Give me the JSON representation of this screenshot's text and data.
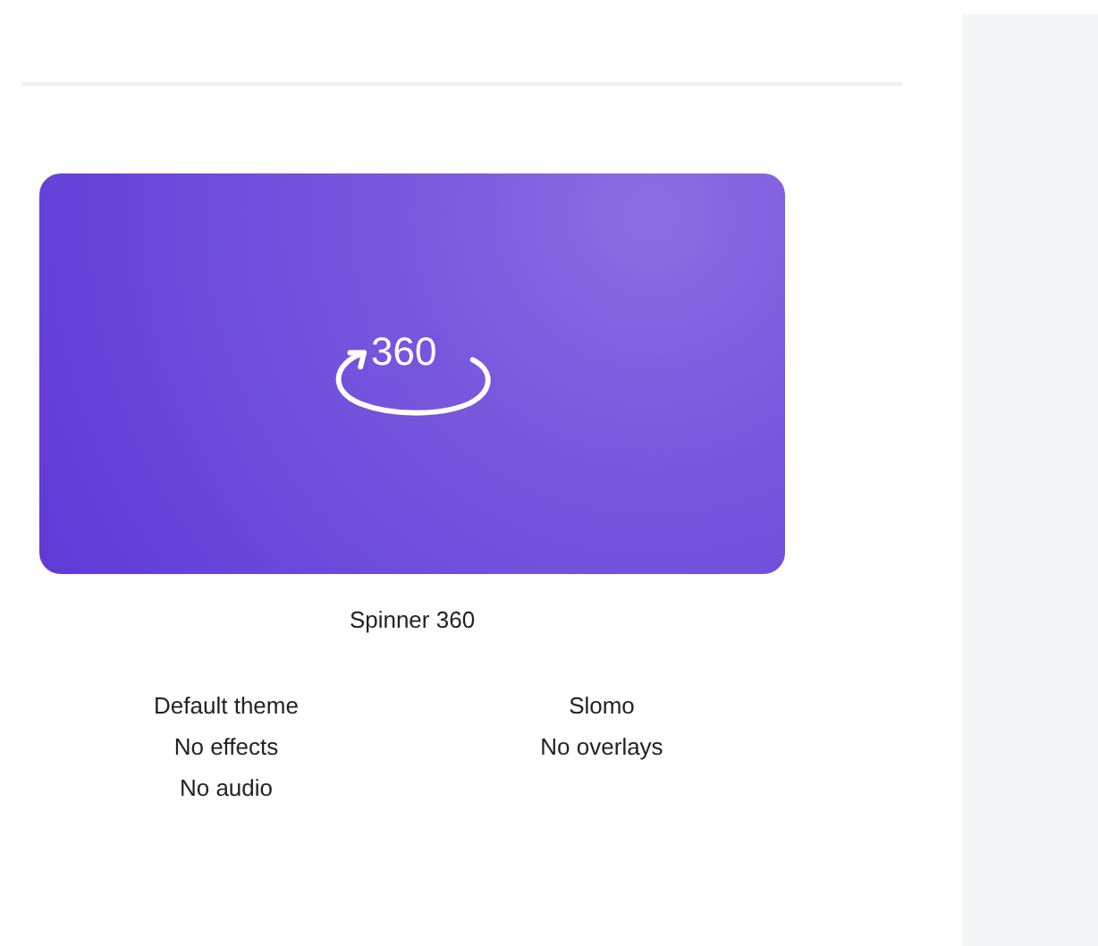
{
  "preview": {
    "badge_text": "360"
  },
  "title": "Spinner 360",
  "detail_columns": [
    {
      "items": [
        "Default theme",
        "No effects",
        "No audio"
      ]
    },
    {
      "items": [
        "Slomo",
        "No overlays"
      ]
    }
  ]
}
